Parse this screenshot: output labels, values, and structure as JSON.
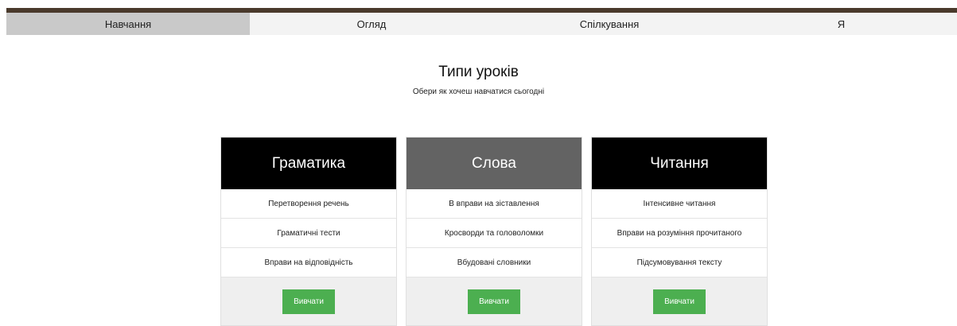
{
  "nav": {
    "items": [
      {
        "label": "Навчання",
        "active": true
      },
      {
        "label": "Огляд",
        "active": false
      },
      {
        "label": "Спілкування",
        "active": false
      },
      {
        "label": "Я",
        "active": false
      }
    ]
  },
  "page": {
    "title": "Типи уроків",
    "subtitle": "Обери як хочеш навчатися сьогодні"
  },
  "cards": [
    {
      "title": "Граматика",
      "header_color": "#000000",
      "items": [
        "Перетворення речень",
        "Граматичні тести",
        "Вправи на відповідність"
      ],
      "button_label": "Вивчати"
    },
    {
      "title": "Слова",
      "header_color": "#636363",
      "items": [
        "В вправи на зіставлення",
        "Кросворди та головоломки",
        "Вбудовані словники"
      ],
      "button_label": "Вивчати"
    },
    {
      "title": "Читання",
      "header_color": "#000000",
      "items": [
        "Інтенсивне читання",
        "Вправи на розуміння прочитаного",
        "Підсумовування тексту"
      ],
      "button_label": "Вивчати"
    }
  ],
  "colors": {
    "accent_button": "#4caf50",
    "top_bar": "#4a3a2c",
    "nav_active": "#c9c9c9"
  }
}
